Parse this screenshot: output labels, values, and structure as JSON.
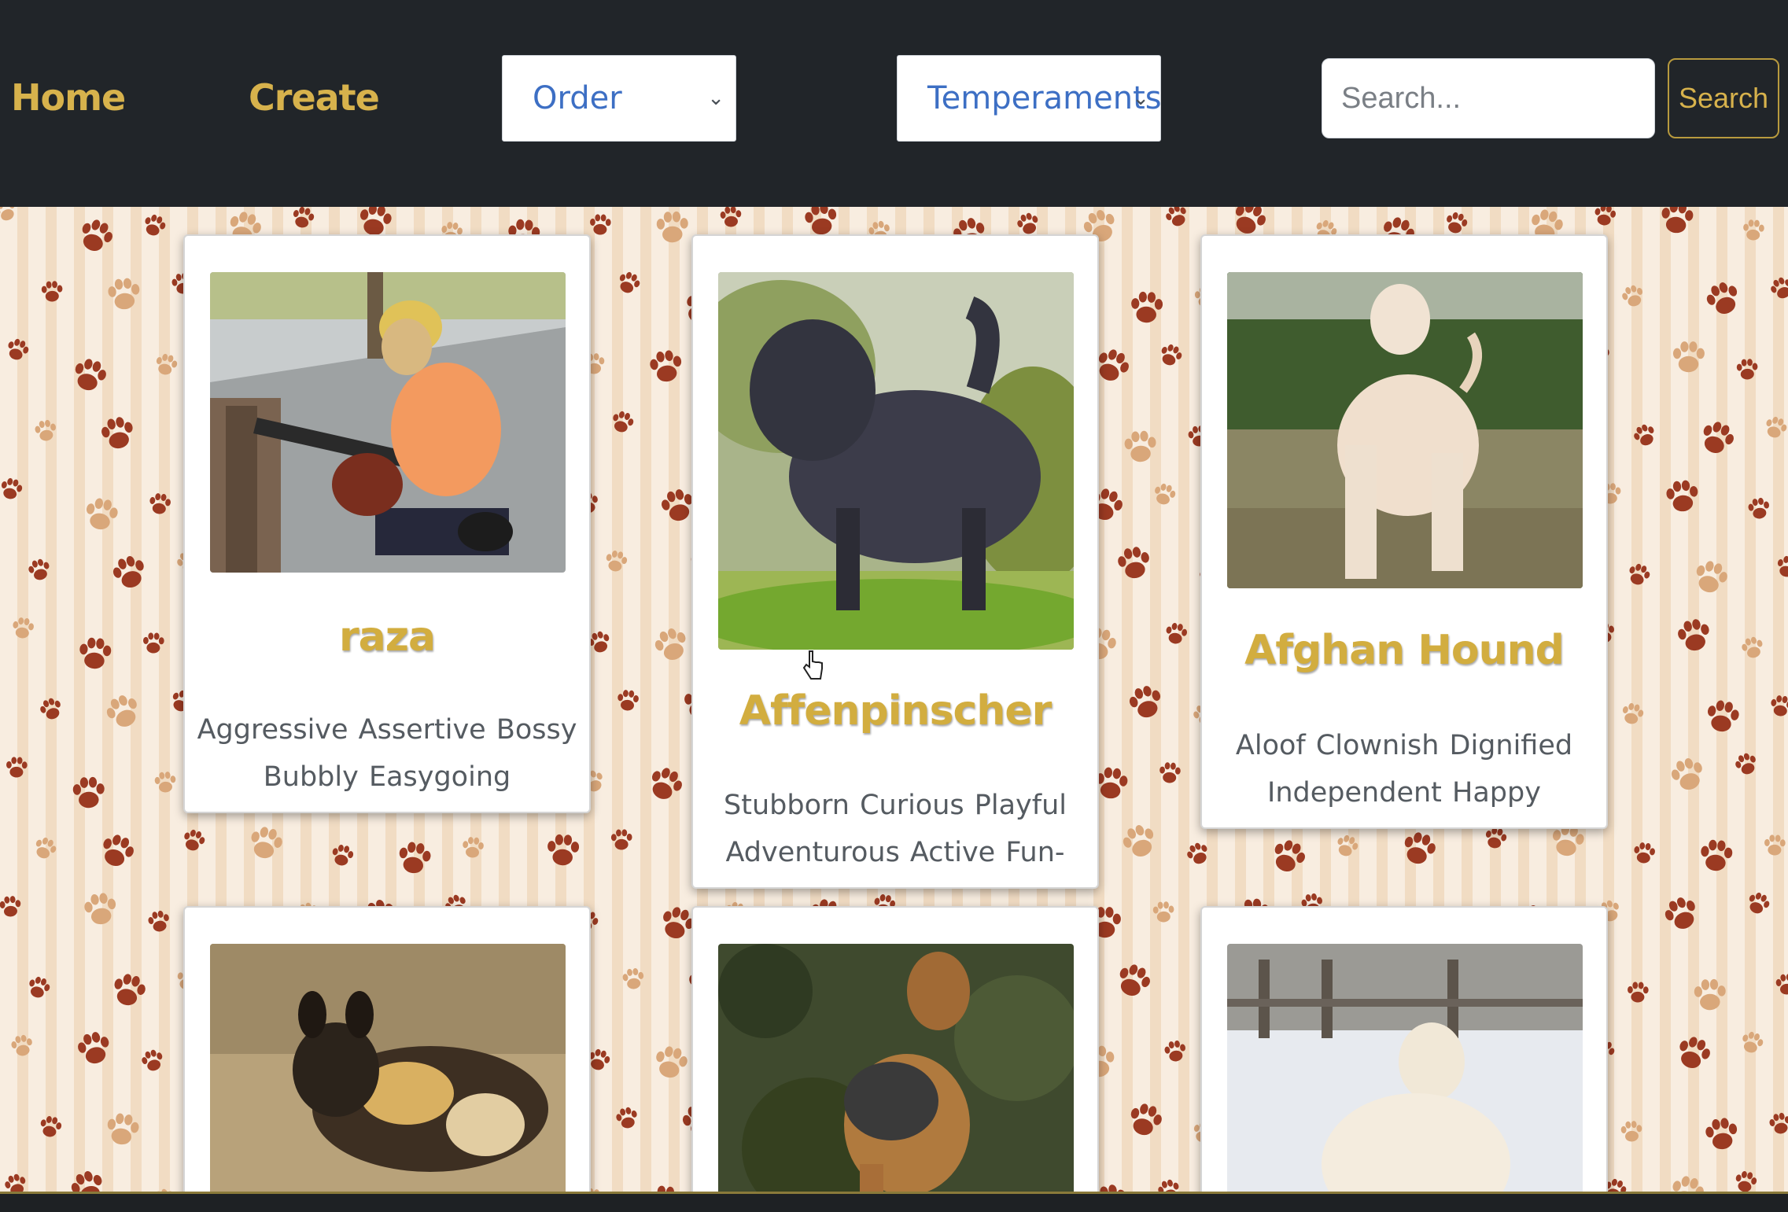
{
  "nav": {
    "home_label": "Home",
    "create_label": "Create",
    "order_select": "Order",
    "temperaments_select": "Temperaments",
    "search_placeholder": "Search...",
    "search_button": "Search"
  },
  "cards": [
    {
      "name": "raza",
      "temperaments": "Aggressive Assertive Bossy Bubbly Easygoing",
      "image": "dog-with-chainsaw-photo"
    },
    {
      "name": "Affenpinscher",
      "temperaments": "Stubborn Curious Playful Adventurous Active Fun-loving",
      "image": "affenpinscher-photo"
    },
    {
      "name": "Afghan Hound",
      "temperaments": "Aloof Clownish Dignified Independent Happy",
      "image": "afghan-hound-photo"
    },
    {
      "name": "",
      "temperaments": "",
      "image": "african-wild-dog-photo"
    },
    {
      "name": "",
      "temperaments": "",
      "image": "airedale-terrier-photo"
    },
    {
      "name": "",
      "temperaments": "",
      "image": "white-dog-in-snow-photo"
    }
  ],
  "colors": {
    "navbar": "#212529",
    "accent_gold": "#d7b24c",
    "select_text": "#3d6fc4",
    "paw_dark": "#9b3a22",
    "paw_light": "#d9a77a"
  }
}
